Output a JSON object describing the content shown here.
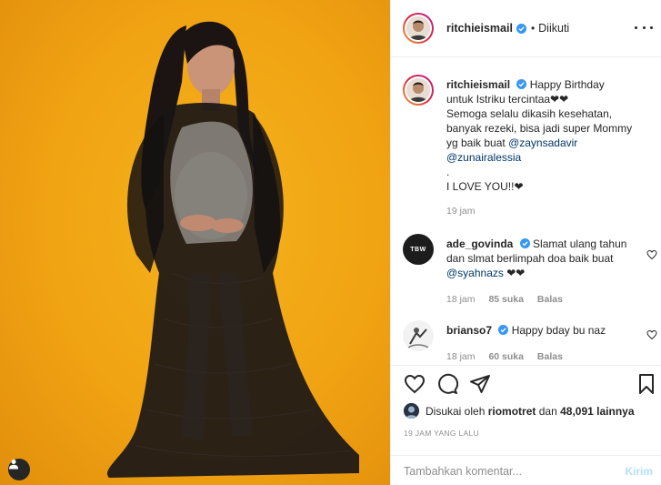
{
  "header": {
    "username": "ritchieismail",
    "separator": "•",
    "follow_state": "Diikuti"
  },
  "caption": {
    "username": "ritchieismail",
    "line1": "Happy Birthday untuk Istriku tercintaa❤❤",
    "line2": "Semoga selalu dikasih kesehatan, banyak rezeki, bisa jadi super Mommy yg baik buat",
    "mention1": "@zaynsadavir",
    "mention2": "@zunairalessia",
    "line3": ".",
    "line4": "I LOVE YOU!!❤",
    "time": "19 jam"
  },
  "comments": [
    {
      "avatar_text": "TBW",
      "username": "ade_govinda",
      "text": "Slamat ulang tahun dan slmat berlimpah doa baik buat",
      "mention": "@syahnazs",
      "suffix": "❤❤",
      "time": "18 jam",
      "likes": "85 suka",
      "reply": "Balas"
    },
    {
      "username": "brianso7",
      "text": "Happy bday bu naz",
      "time": "18 jam",
      "likes": "60 suka",
      "reply": "Balas"
    }
  ],
  "likes": {
    "prefix": "Disukai oleh",
    "liker": "riomotret",
    "joiner": "dan",
    "count": "48,091 lainnya"
  },
  "timestamp": "19 JAM YANG LALU",
  "add_comment": {
    "placeholder": "Tambahkan komentar...",
    "post_label": "Kirim"
  },
  "icons": {
    "verified": "verified-badge-icon",
    "like": "heart-icon",
    "comment": "comment-bubble-icon",
    "share": "paper-plane-icon",
    "save": "bookmark-icon",
    "tag": "user-tag-icon",
    "more": "more-options-icon"
  },
  "colors": {
    "photo_background": "#f0a313",
    "verified": "#3897f0",
    "mention": "#00376b",
    "post_button_disabled": "#b2dffc",
    "meta_text": "#8e8e8e"
  }
}
